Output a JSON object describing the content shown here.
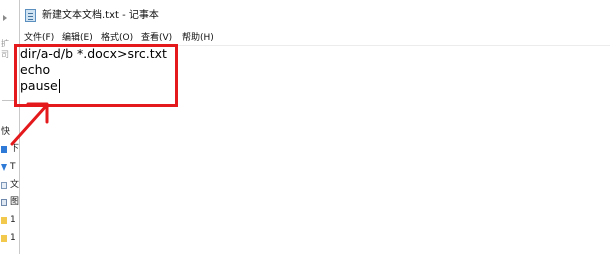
{
  "window": {
    "title": "新建文本文档.txt - 记事本"
  },
  "menu": {
    "items": [
      {
        "label": "文件(F)"
      },
      {
        "label": "编辑(E)"
      },
      {
        "label": "格式(O)"
      },
      {
        "label": "查看(V)"
      },
      {
        "label": "帮助(H)"
      }
    ]
  },
  "editor": {
    "lines": [
      "dir/a-d/b *.docx>src.txt",
      "echo",
      "pause"
    ]
  },
  "background_explorer": {
    "fragments": [
      "扩",
      "司",
      "快"
    ],
    "nav_labels": [
      "下",
      "T",
      "文",
      "图",
      "1",
      "1"
    ]
  },
  "annotation": {
    "color": "#e3191c"
  }
}
